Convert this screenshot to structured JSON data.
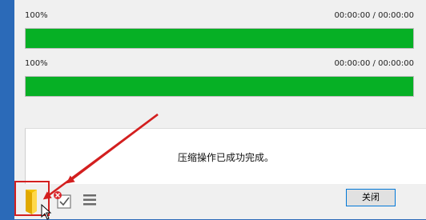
{
  "progress": [
    {
      "percent_label": "100%",
      "time_label": "00:00:00 / 00:00:00",
      "fraction": 1.0
    },
    {
      "percent_label": "100%",
      "time_label": "00:00:00 / 00:00:00",
      "fraction": 1.0
    }
  ],
  "message": "压缩操作已成功完成。",
  "buttons": {
    "close": "关闭"
  },
  "icons": {
    "open_folder": "folder-icon",
    "delete_check": "delete-check-icon",
    "menu": "menu-icon"
  },
  "colors": {
    "progress_fill": "#06b025",
    "annotation": "#d31f1f",
    "button_border": "#0078d7"
  }
}
